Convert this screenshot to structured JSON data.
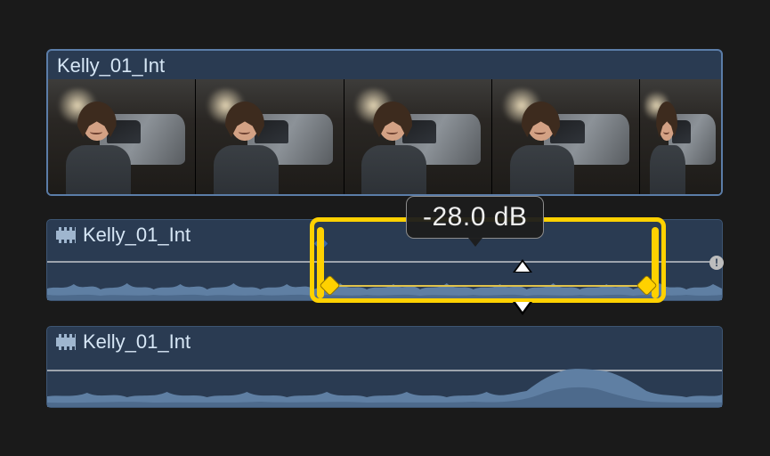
{
  "video_clip": {
    "title": "Kelly_01_Int"
  },
  "audio_clip_1": {
    "title": "Kelly_01_Int",
    "volume_db": "-28.0 dB"
  },
  "audio_clip_2": {
    "title": "Kelly_01_Int"
  },
  "colors": {
    "selection": "#ffd100",
    "clip_bg": "#2a3b52",
    "clip_border": "#5b7da8",
    "text": "#d6e6f5"
  }
}
